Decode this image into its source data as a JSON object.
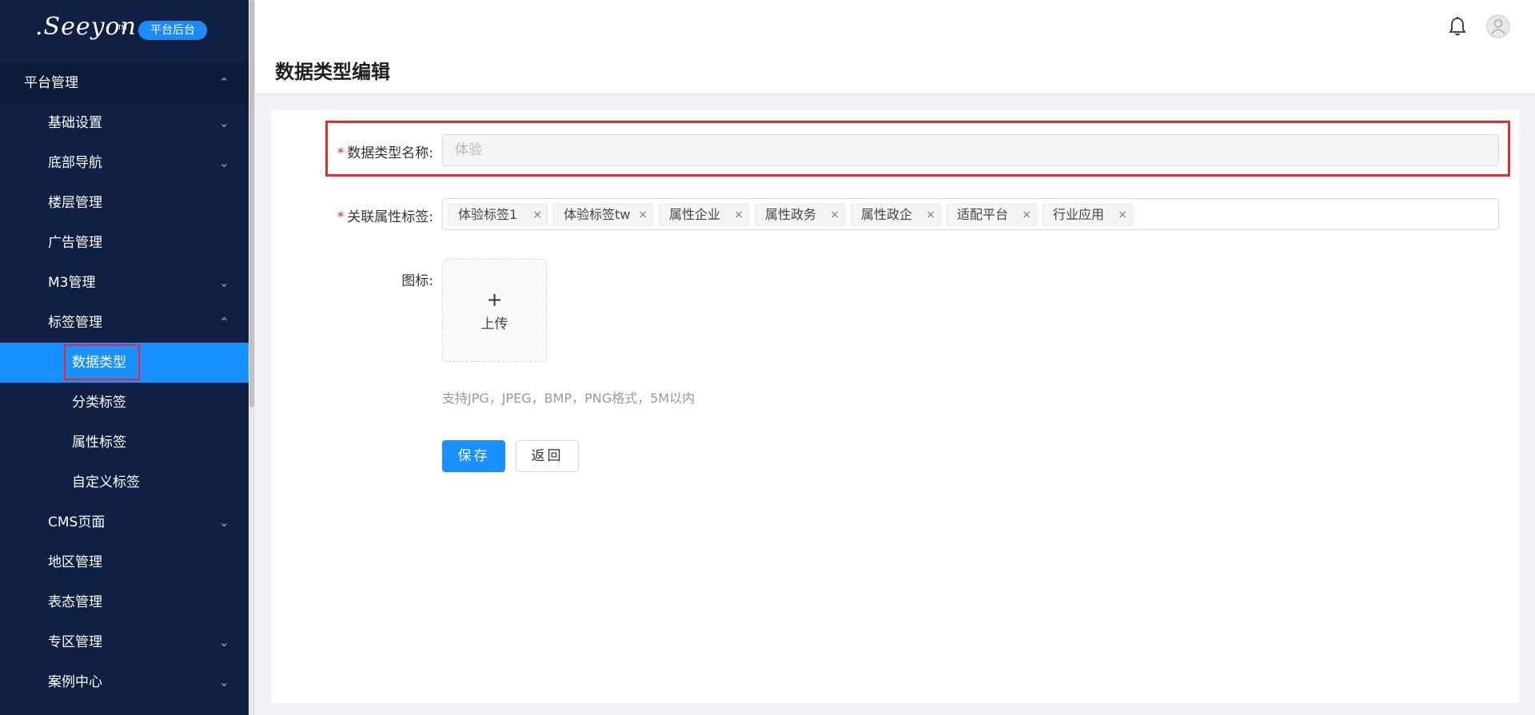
{
  "sidebar": {
    "logo_text": ".Seeyon",
    "logo_tm": "TM",
    "badge": "平台后台",
    "items": [
      {
        "label": "平台管理",
        "level": 1,
        "chevron": "up"
      },
      {
        "label": "基础设置",
        "level": 2,
        "chevron": "down"
      },
      {
        "label": "底部导航",
        "level": 2,
        "chevron": "down"
      },
      {
        "label": "楼层管理",
        "level": 2,
        "chevron": ""
      },
      {
        "label": "广告管理",
        "level": 2,
        "chevron": ""
      },
      {
        "label": "M3管理",
        "level": 2,
        "chevron": "down"
      },
      {
        "label": "标签管理",
        "level": 2,
        "chevron": "up"
      },
      {
        "label": "数据类型",
        "level": 3,
        "chevron": "",
        "active": true
      },
      {
        "label": "分类标签",
        "level": 3,
        "chevron": ""
      },
      {
        "label": "属性标签",
        "level": 3,
        "chevron": ""
      },
      {
        "label": "自定义标签",
        "level": 3,
        "chevron": ""
      },
      {
        "label": "CMS页面",
        "level": 2,
        "chevron": "down"
      },
      {
        "label": "地区管理",
        "level": 2,
        "chevron": ""
      },
      {
        "label": "表态管理",
        "level": 2,
        "chevron": ""
      },
      {
        "label": "专区管理",
        "level": 2,
        "chevron": "down"
      },
      {
        "label": "案例中心",
        "level": 2,
        "chevron": "down"
      }
    ]
  },
  "header": {
    "title": "数据类型编辑"
  },
  "form": {
    "name_label": "数据类型名称:",
    "name_value": "体验",
    "tags_label": "关联属性标签:",
    "tags": [
      "体验标签1",
      "体验标签tw",
      "属性企业",
      "属性政务",
      "属性政企",
      "适配平台",
      "行业应用"
    ],
    "icon_label": "图标:",
    "upload_plus": "+",
    "upload_text": "上传",
    "hint": "支持JPG，JPEG，BMP，PNG格式，5M以内",
    "save_label": "保存",
    "back_label": "返回",
    "required_mark": "*"
  },
  "colors": {
    "sidebar_bg": "#0f2044",
    "accent": "#1890ff",
    "highlight_border": "#e02f2f"
  }
}
